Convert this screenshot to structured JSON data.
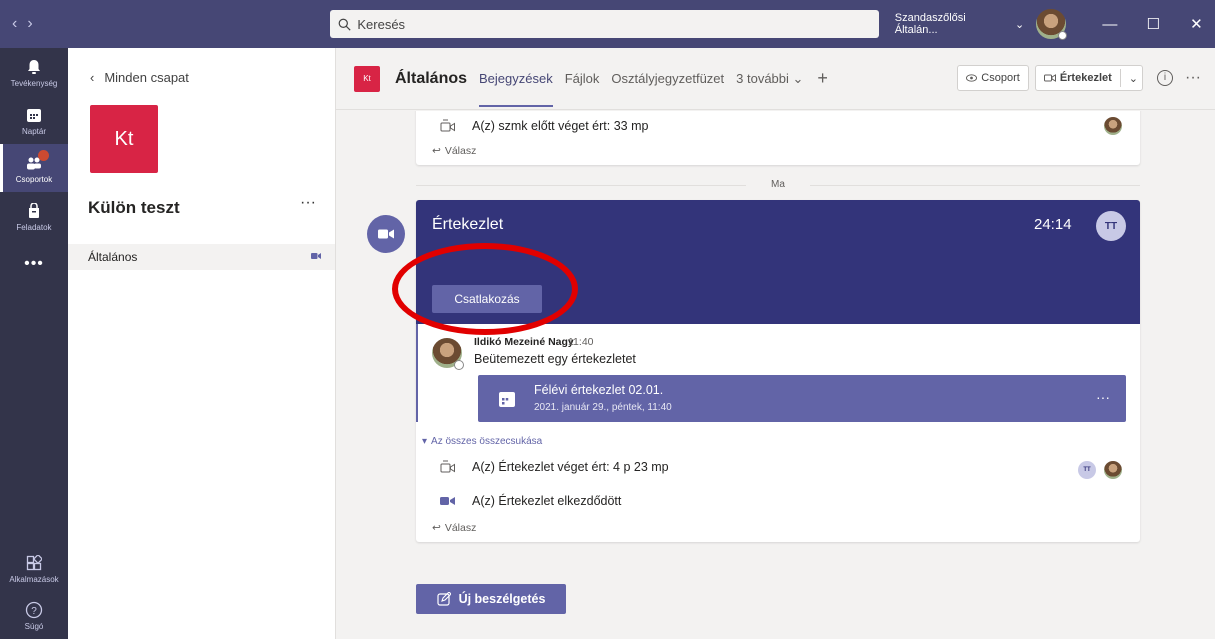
{
  "titlebar": {
    "back": "‹",
    "forward": "›",
    "search_placeholder": "Keresés",
    "tenant": "Szandaszőlősi Általán...",
    "minimize": "—",
    "maximize": "☐",
    "close": "✕"
  },
  "rail": {
    "items": [
      {
        "label": "Tevékenység"
      },
      {
        "label": "Naptár"
      },
      {
        "label": "Csoportok"
      },
      {
        "label": "Feladatok"
      }
    ],
    "more": "•••",
    "apps": "Alkalmazások",
    "help": "Súgó"
  },
  "sidebar": {
    "back_label": "Minden csapat",
    "team_initials": "Kt",
    "team_name": "Külön teszt",
    "team_more": "···",
    "channel": "Általános"
  },
  "header": {
    "logo_initials": "Kt",
    "channel_title": "Általános",
    "tabs": [
      "Bejegyzések",
      "Fájlok",
      "Osztályjegyzetfüzet",
      "3 további ⌄"
    ],
    "add_tab": "+",
    "group_button": "Csoport",
    "meeting_button": "Értekezlet",
    "info": "i",
    "more": "···"
  },
  "feed": {
    "top_event": "A(z) szmk előtt véget ért: 33 mp",
    "reply_label": "Válasz",
    "date_separator": "Ma",
    "meeting": {
      "title": "Értekezlet",
      "timer": "24:14",
      "participant_initials": "TT",
      "join_label": "Csatlakozás"
    },
    "message": {
      "author": "Ildikó Mezeiné Nagy",
      "time": "11:40",
      "text": "Beütemezett egy értekezletet",
      "event_title": "Félévi értekezlet 02.01.",
      "event_date": "2021. január 29., péntek, 11:40",
      "event_more": "···"
    },
    "collapse_all": "Az összes összecsukása",
    "ended_event": "A(z) Értekezlet véget ért: 4 p 23 mp",
    "started_event": "A(z) Értekezlet elkezdődött",
    "ended_participant_initials": "TT",
    "new_conversation": "Új beszélgetés"
  },
  "colors": {
    "titlebar": "#464775",
    "rail": "#33344a",
    "accent": "#6264a7",
    "meeting_banner": "#33347a",
    "team_logo": "#d82445",
    "annotation": "#e10000"
  }
}
